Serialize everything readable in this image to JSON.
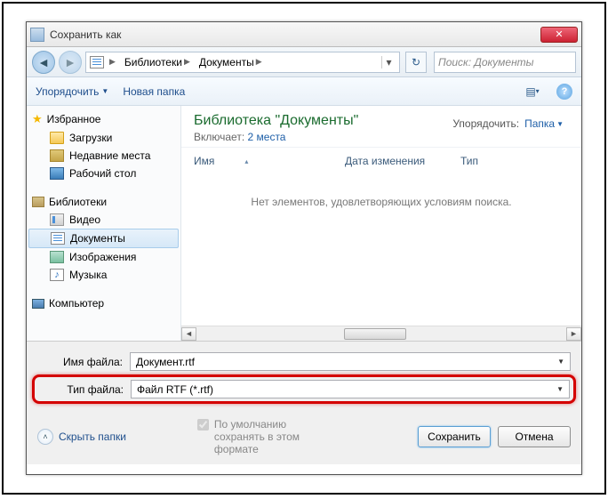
{
  "window": {
    "title": "Сохранить как"
  },
  "nav": {
    "crumbs": [
      "Библиотеки",
      "Документы"
    ],
    "search_placeholder": "Поиск: Документы"
  },
  "toolbar": {
    "organize": "Упорядочить",
    "new_folder": "Новая папка"
  },
  "sidebar": {
    "favorites": {
      "label": "Избранное",
      "items": [
        "Загрузки",
        "Недавние места",
        "Рабочий стол"
      ]
    },
    "libraries": {
      "label": "Библиотеки",
      "items": [
        "Видео",
        "Документы",
        "Изображения",
        "Музыка"
      ]
    },
    "computer": {
      "label": "Компьютер"
    }
  },
  "content": {
    "title": "Библиотека \"Документы\"",
    "subtitle_prefix": "Включает:",
    "subtitle_link": "2 места",
    "arrange_label": "Упорядочить:",
    "arrange_value": "Папка",
    "cols": {
      "name": "Имя",
      "date": "Дата изменения",
      "type": "Тип"
    },
    "empty": "Нет элементов, удовлетворяющих условиям поиска."
  },
  "fields": {
    "filename_label": "Имя файла:",
    "filename_value": "Документ.rtf",
    "filetype_label": "Тип файла:",
    "filetype_value": "Файл RTF (*.rtf)"
  },
  "footer": {
    "hide_folders": "Скрыть папки",
    "default_format": "По умолчанию сохранять в этом формате",
    "save": "Сохранить",
    "cancel": "Отмена"
  }
}
